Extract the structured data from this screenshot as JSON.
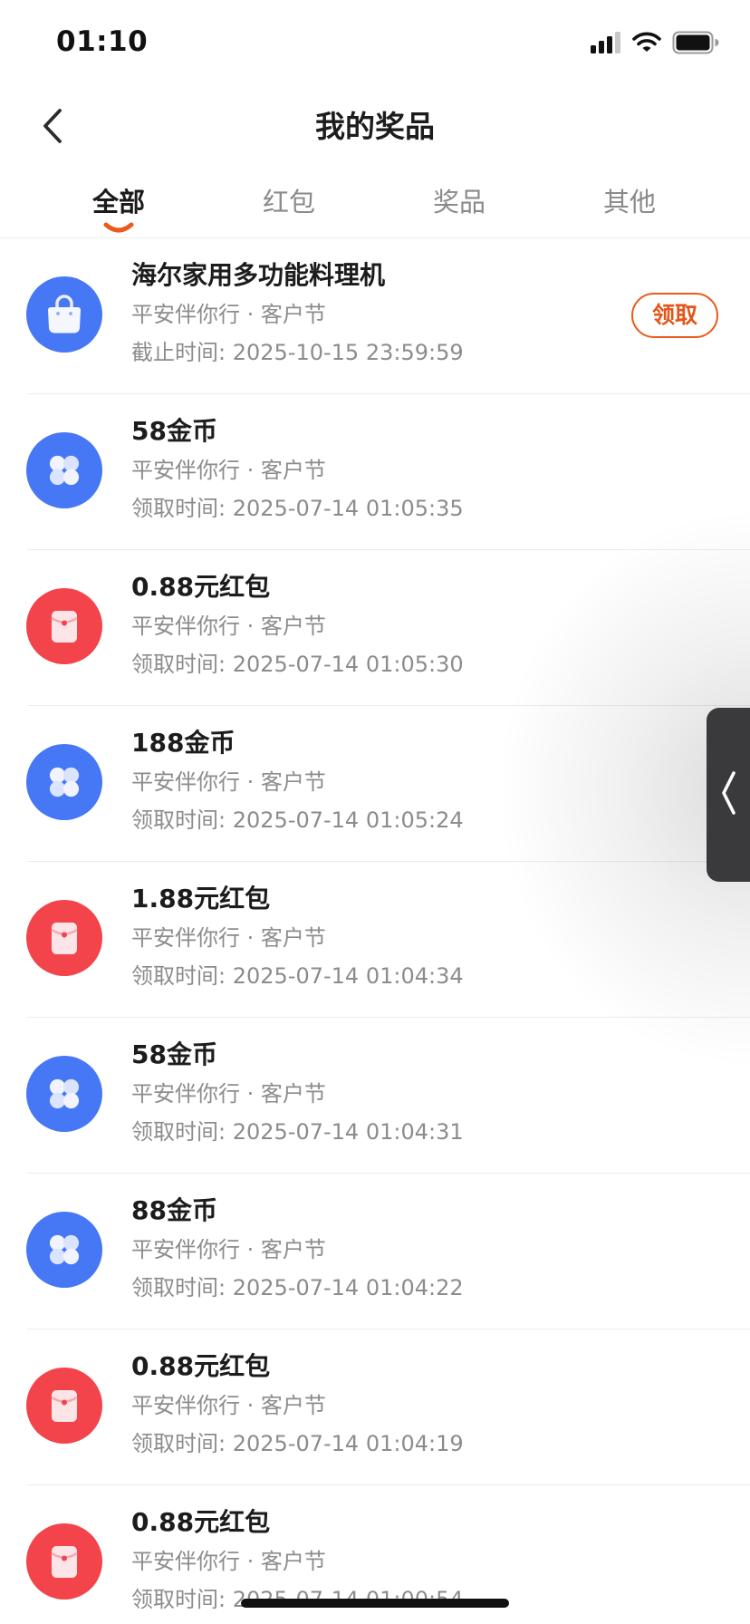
{
  "status_bar": {
    "time": "01:10"
  },
  "header": {
    "title": "我的奖品",
    "back_icon": "chevron-left-icon"
  },
  "tabs": [
    {
      "label": "全部",
      "active": true
    },
    {
      "label": "红包",
      "active": false
    },
    {
      "label": "奖品",
      "active": false
    },
    {
      "label": "其他",
      "active": false
    }
  ],
  "colors": {
    "accent": "#ea5a1c",
    "coin_blue": "#4677f5",
    "red_packet": "#f3434b",
    "handle": "#3a3a3c"
  },
  "prizes": [
    {
      "title": "海尔家用多功能料理机",
      "subtitle": "平安伴你行 · 客户节",
      "time": "截止时间: 2025-10-15 23:59:59",
      "icon": "shopping-bag-icon",
      "action": "领取"
    },
    {
      "title": "58金币",
      "subtitle": "平安伴你行 · 客户节",
      "time": "领取时间: 2025-07-14 01:05:35",
      "icon": "coin-icon"
    },
    {
      "title": "0.88元红包",
      "subtitle": "平安伴你行 · 客户节",
      "time": "领取时间: 2025-07-14 01:05:30",
      "icon": "red-envelope-icon"
    },
    {
      "title": "188金币",
      "subtitle": "平安伴你行 · 客户节",
      "time": "领取时间: 2025-07-14 01:05:24",
      "icon": "coin-icon"
    },
    {
      "title": "1.88元红包",
      "subtitle": "平安伴你行 · 客户节",
      "time": "领取时间: 2025-07-14 01:04:34",
      "icon": "red-envelope-icon"
    },
    {
      "title": "58金币",
      "subtitle": "平安伴你行 · 客户节",
      "time": "领取时间: 2025-07-14 01:04:31",
      "icon": "coin-icon"
    },
    {
      "title": "88金币",
      "subtitle": "平安伴你行 · 客户节",
      "time": "领取时间: 2025-07-14 01:04:22",
      "icon": "coin-icon"
    },
    {
      "title": "0.88元红包",
      "subtitle": "平安伴你行 · 客户节",
      "time": "领取时间: 2025-07-14 01:04:19",
      "icon": "red-envelope-icon"
    },
    {
      "title": "0.88元红包",
      "subtitle": "平安伴你行 · 客户节",
      "time": "领取时间: 2025-07-14 01:00:54",
      "icon": "red-envelope-icon"
    }
  ],
  "side_handle": {
    "icon": "chevron-left-icon"
  }
}
